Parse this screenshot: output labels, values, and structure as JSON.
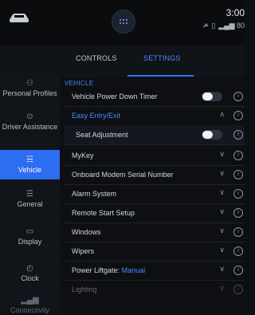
{
  "status": {
    "time": "3:00",
    "signal": "▂▄▆ 80",
    "icons": [
      "bluetooth-off-icon",
      "phone-icon"
    ]
  },
  "tabs": [
    {
      "label": "CONTROLS"
    },
    {
      "label": "SETTINGS"
    }
  ],
  "sidebar": {
    "items": [
      {
        "label": "Personal Profiles",
        "icon": "profiles-icon",
        "glyph": "⚇"
      },
      {
        "label": "Driver Assistance",
        "icon": "driver-assist-icon",
        "glyph": "⊙"
      },
      {
        "label": "Vehicle",
        "icon": "vehicle-icon",
        "glyph": "☵"
      },
      {
        "label": "General",
        "icon": "sliders-icon",
        "glyph": "☰"
      },
      {
        "label": "Display",
        "icon": "display-icon",
        "glyph": "▭"
      },
      {
        "label": "Clock",
        "icon": "clock-icon",
        "glyph": "◴"
      },
      {
        "label": "Connectivity",
        "icon": "signal-icon",
        "glyph": "▂▄▆"
      }
    ]
  },
  "main": {
    "section": "VEHICLE",
    "rows": [
      {
        "label": "Vehicle Power Down Timer",
        "control": "toggle"
      },
      {
        "label": "Easy Entry/Exit",
        "control": "chevron-up"
      },
      {
        "label": "Seat Adjustment",
        "control": "toggle"
      },
      {
        "label": "MyKey",
        "control": "chevron-down"
      },
      {
        "label": "Onboard Modem Serial Number",
        "control": "chevron-down"
      },
      {
        "label": "Alarm System",
        "control": "chevron-down"
      },
      {
        "label": "Remote Start Setup",
        "control": "chevron-down"
      },
      {
        "label": "Windows",
        "control": "chevron-down"
      },
      {
        "label": "Wipers",
        "control": "chevron-down"
      },
      {
        "label": "Power Liftgate:",
        "value": "Manual",
        "control": "chevron-down"
      },
      {
        "label": "Lighting",
        "control": "chevron-down"
      }
    ]
  },
  "colors": {
    "accent": "#2f74ff",
    "active_sidebar": "#2d6df2",
    "background": "#0d0f12"
  }
}
